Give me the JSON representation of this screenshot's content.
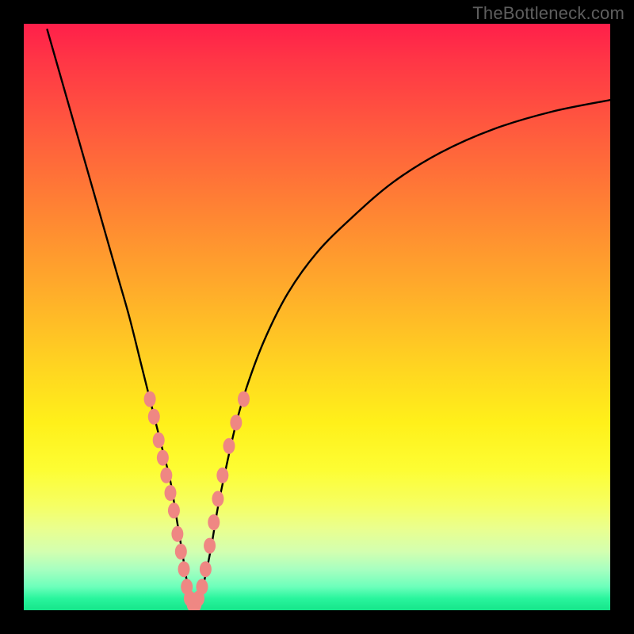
{
  "watermark": "TheBottleneck.com",
  "colors": {
    "frame": "#000000",
    "watermark_text": "#5e5e5e",
    "curve_stroke": "#000000",
    "marker_fill": "#ef8783",
    "gradient_top": "#ff1f4a",
    "gradient_bottom": "#16e58a"
  },
  "chart_data": {
    "type": "line",
    "title": "",
    "xlabel": "",
    "ylabel": "",
    "xlim": [
      0,
      100
    ],
    "ylim": [
      0,
      100
    ],
    "grid": false,
    "legend": false,
    "series": [
      {
        "name": "bottleneck-curve",
        "x": [
          4,
          6,
          8,
          10,
          12,
          14,
          16,
          18,
          20,
          22,
          23.5,
          25,
          26,
          27,
          27.8,
          28.5,
          29,
          29.5,
          30,
          31,
          32,
          33,
          34,
          36,
          38,
          41,
          45,
          50,
          56,
          63,
          71,
          80,
          90,
          100
        ],
        "y": [
          99,
          92,
          85,
          78,
          71,
          64,
          57,
          50,
          42,
          34,
          28,
          22,
          16,
          10,
          5,
          2,
          0.5,
          0.5,
          2,
          6,
          11,
          17,
          22,
          31,
          38,
          46,
          54,
          61,
          67,
          73,
          78,
          82,
          85,
          87
        ]
      }
    ],
    "markers": {
      "name": "data-points",
      "x": [
        21.5,
        22.2,
        23.0,
        23.7,
        24.3,
        25.0,
        25.6,
        26.2,
        26.8,
        27.3,
        27.8,
        28.3,
        28.8,
        29.3,
        29.8,
        30.4,
        31.0,
        31.7,
        32.4,
        33.1,
        33.9,
        35.0,
        36.2,
        37.5
      ],
      "y": [
        36,
        33,
        29,
        26,
        23,
        20,
        17,
        13,
        10,
        7,
        4,
        2,
        1,
        1,
        2,
        4,
        7,
        11,
        15,
        19,
        23,
        28,
        32,
        36
      ]
    }
  }
}
